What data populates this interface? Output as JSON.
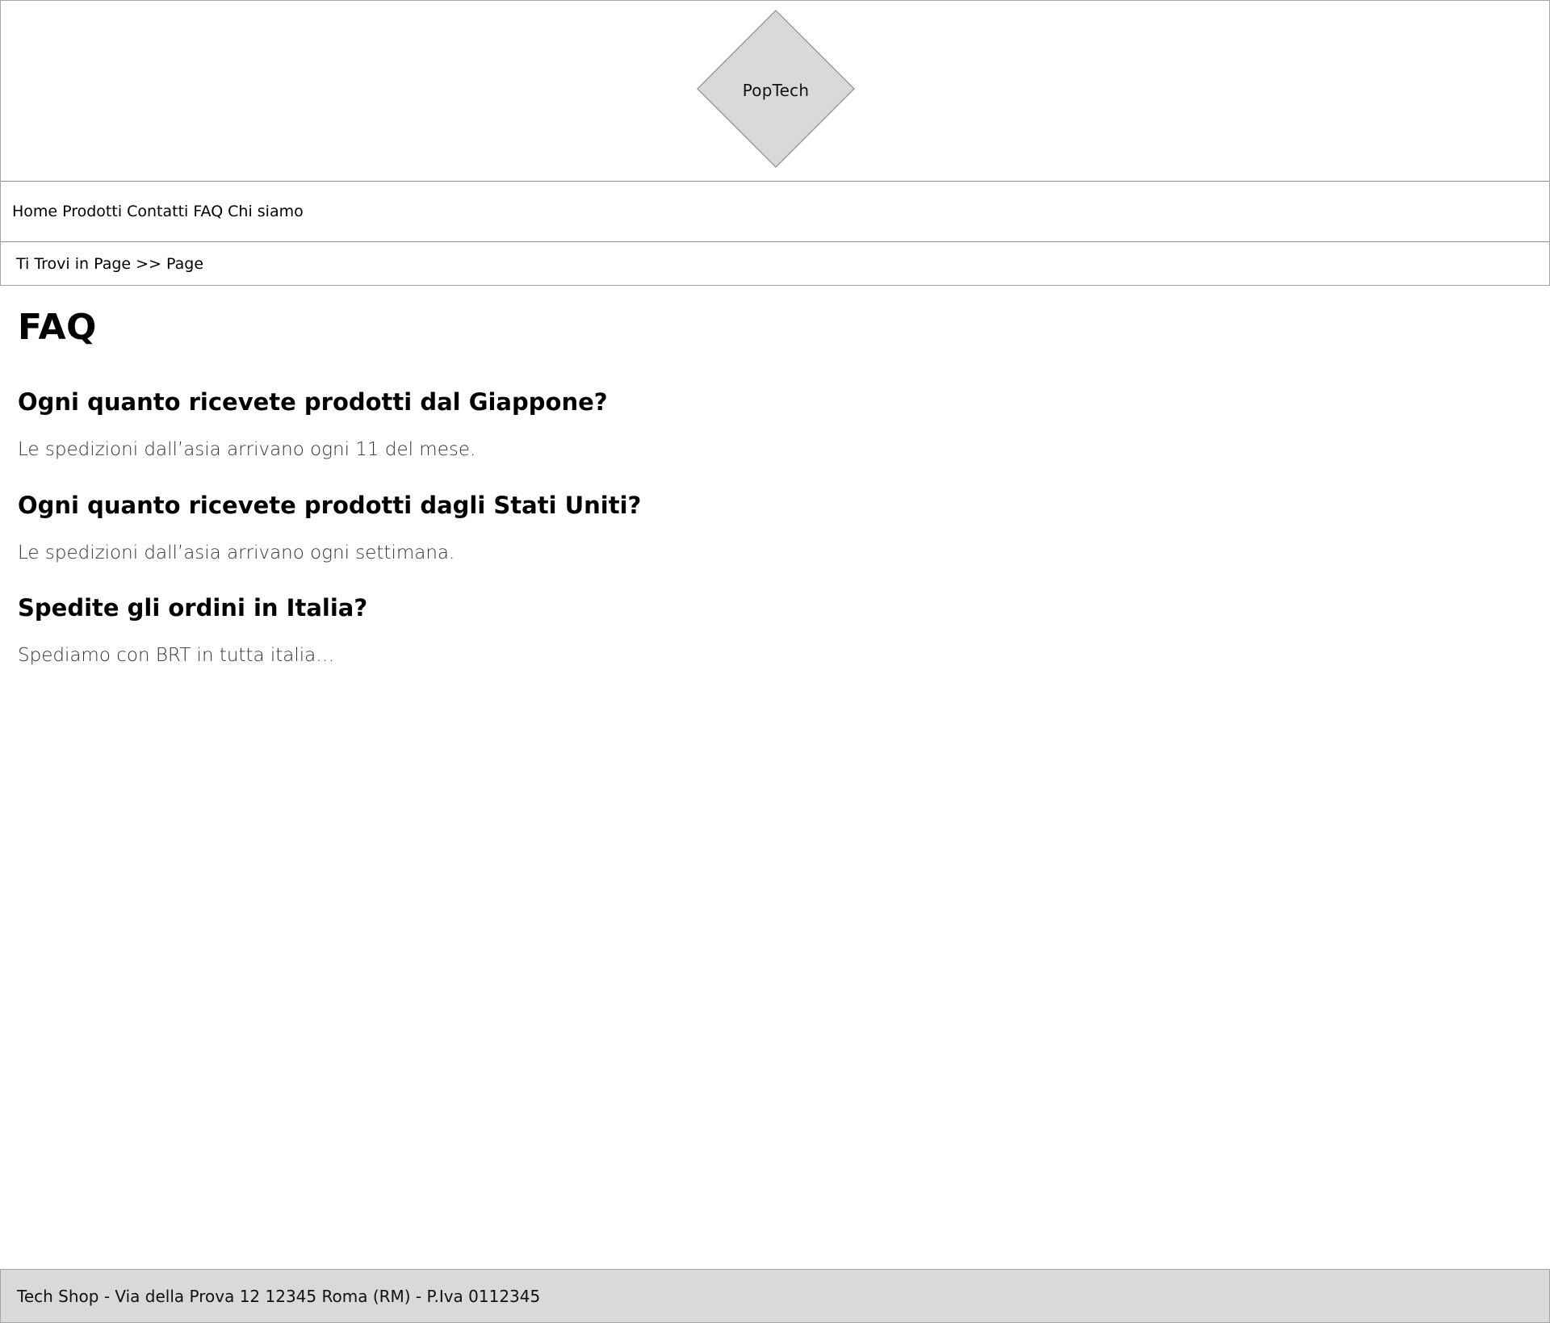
{
  "header": {
    "logo_text": "PopTech",
    "logo_fill": "#d9d9d9",
    "logo_stroke": "#8c8c8c"
  },
  "nav": {
    "items": [
      {
        "label": "Home"
      },
      {
        "label": "Prodotti"
      },
      {
        "label": "Contatti"
      },
      {
        "label": "FAQ"
      },
      {
        "label": "Chi siamo"
      }
    ]
  },
  "breadcrumb": {
    "text": "Ti Trovi in Page >> Page"
  },
  "main": {
    "title": "FAQ",
    "faqs": [
      {
        "question": "Ogni quanto ricevete prodotti dal Giappone?",
        "answer": "Le spedizioni dall’asia arrivano ogni 11 del mese."
      },
      {
        "question": "Ogni quanto ricevete prodotti dagli Stati Uniti?",
        "answer": "Le spedizioni dall’asia arrivano ogni settimana."
      },
      {
        "question": "Spedite gli ordini in Italia?",
        "answer": "Spediamo con BRT in tutta italia…"
      }
    ]
  },
  "footer": {
    "text": "Tech Shop - Via della Prova 12 12345 Roma (RM) - P.Iva 0112345",
    "background": "#d9d9d9"
  }
}
